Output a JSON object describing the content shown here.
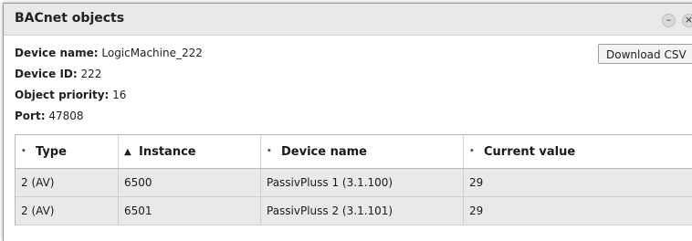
{
  "window": {
    "title": "BACnet objects",
    "minimize_label": "–",
    "close_label": "×"
  },
  "device": {
    "name_label": "Device name:",
    "name_value": "LogicMachine_222",
    "id_label": "Device ID:",
    "id_value": "222",
    "priority_label": "Object priority:",
    "priority_value": "16",
    "port_label": "Port:",
    "port_value": "47808"
  },
  "toolbar": {
    "download_csv_label": "Download CSV"
  },
  "table": {
    "columns": [
      {
        "label": "Type",
        "sort_glyph": "•"
      },
      {
        "label": "Instance",
        "sort_glyph": "▲"
      },
      {
        "label": "Device name",
        "sort_glyph": "•"
      },
      {
        "label": "Current value",
        "sort_glyph": "•"
      }
    ],
    "rows": [
      {
        "type": "2 (AV)",
        "instance": "6500",
        "device_name": "PassivPluss 1 (3.1.100)",
        "current_value": "29"
      },
      {
        "type": "2 (AV)",
        "instance": "6501",
        "device_name": "PassivPluss 2 (3.1.101)",
        "current_value": "29"
      }
    ]
  },
  "colors": {
    "titlebar_bg": "#e9e9e9",
    "row_bg": "#e9e9e9",
    "border": "#b8b8b8"
  }
}
